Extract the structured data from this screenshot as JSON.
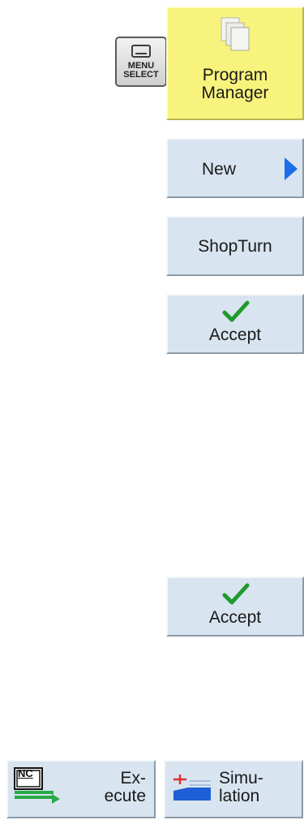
{
  "menu_select_key": {
    "line1": "MENU",
    "line2": "SELECT",
    "icon": "screen-icon"
  },
  "softkeys": {
    "program_manager": {
      "line1": "Program",
      "line2": "Manager",
      "icon": "documents-icon"
    },
    "new": {
      "label": "New",
      "icon": "arrow-right-icon"
    },
    "shopturn": {
      "label": "ShopTurn"
    },
    "accept_1": {
      "label": "Accept",
      "icon": "checkmark-icon"
    },
    "accept_2": {
      "label": "Accept",
      "icon": "checkmark-icon"
    },
    "execute": {
      "line1": "Ex-",
      "line2": "ecute",
      "badge": "NC",
      "icon": "nc-execute-icon"
    },
    "simulation": {
      "line1": "Simu-",
      "line2": "lation",
      "icon": "simulation-icon"
    }
  },
  "colors": {
    "softkey_bg": "#d8e4ef",
    "active_softkey_bg": "#f7f37c",
    "arrow_blue": "#1a6fe8",
    "check_green": "#1f9a2a",
    "execute_green": "#2aa84a",
    "sim_blue": "#1f5fd6",
    "sim_red": "#e53030"
  }
}
